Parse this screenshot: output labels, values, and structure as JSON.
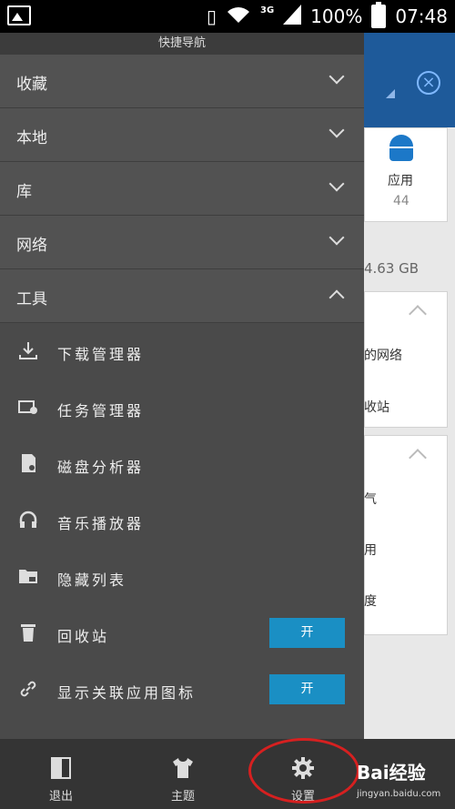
{
  "status": {
    "network": "3G",
    "battery": "100%",
    "time": "07:48"
  },
  "background": {
    "card_label": "应用",
    "card_count": "44",
    "storage": "4.63 GB",
    "rows": [
      "的网络",
      "收站",
      "气",
      "用",
      "度"
    ]
  },
  "drawer": {
    "title": "快捷导航",
    "sections": [
      {
        "label": "收藏",
        "expanded": false
      },
      {
        "label": "本地",
        "expanded": false
      },
      {
        "label": "库",
        "expanded": false
      },
      {
        "label": "网络",
        "expanded": false
      },
      {
        "label": "工具",
        "expanded": true
      }
    ],
    "tools": [
      {
        "label": "下载管理器",
        "icon": "download-icon"
      },
      {
        "label": "任务管理器",
        "icon": "task-manager-icon"
      },
      {
        "label": "磁盘分析器",
        "icon": "sd-card-icon"
      },
      {
        "label": "音乐播放器",
        "icon": "headphones-icon"
      },
      {
        "label": "隐藏列表",
        "icon": "locked-folder-icon"
      },
      {
        "label": "回收站",
        "icon": "trash-icon",
        "toggle": "开"
      },
      {
        "label": "显示关联应用图标",
        "icon": "link-icon",
        "toggle": "开"
      }
    ]
  },
  "bottom": {
    "exit": "退出",
    "theme": "主题",
    "settings": "设置"
  },
  "watermark": {
    "brand": "Bai经验",
    "url": "jingyan.baidu.com"
  },
  "colors": {
    "accent": "#1a8fc4",
    "annotation": "#d62020"
  }
}
